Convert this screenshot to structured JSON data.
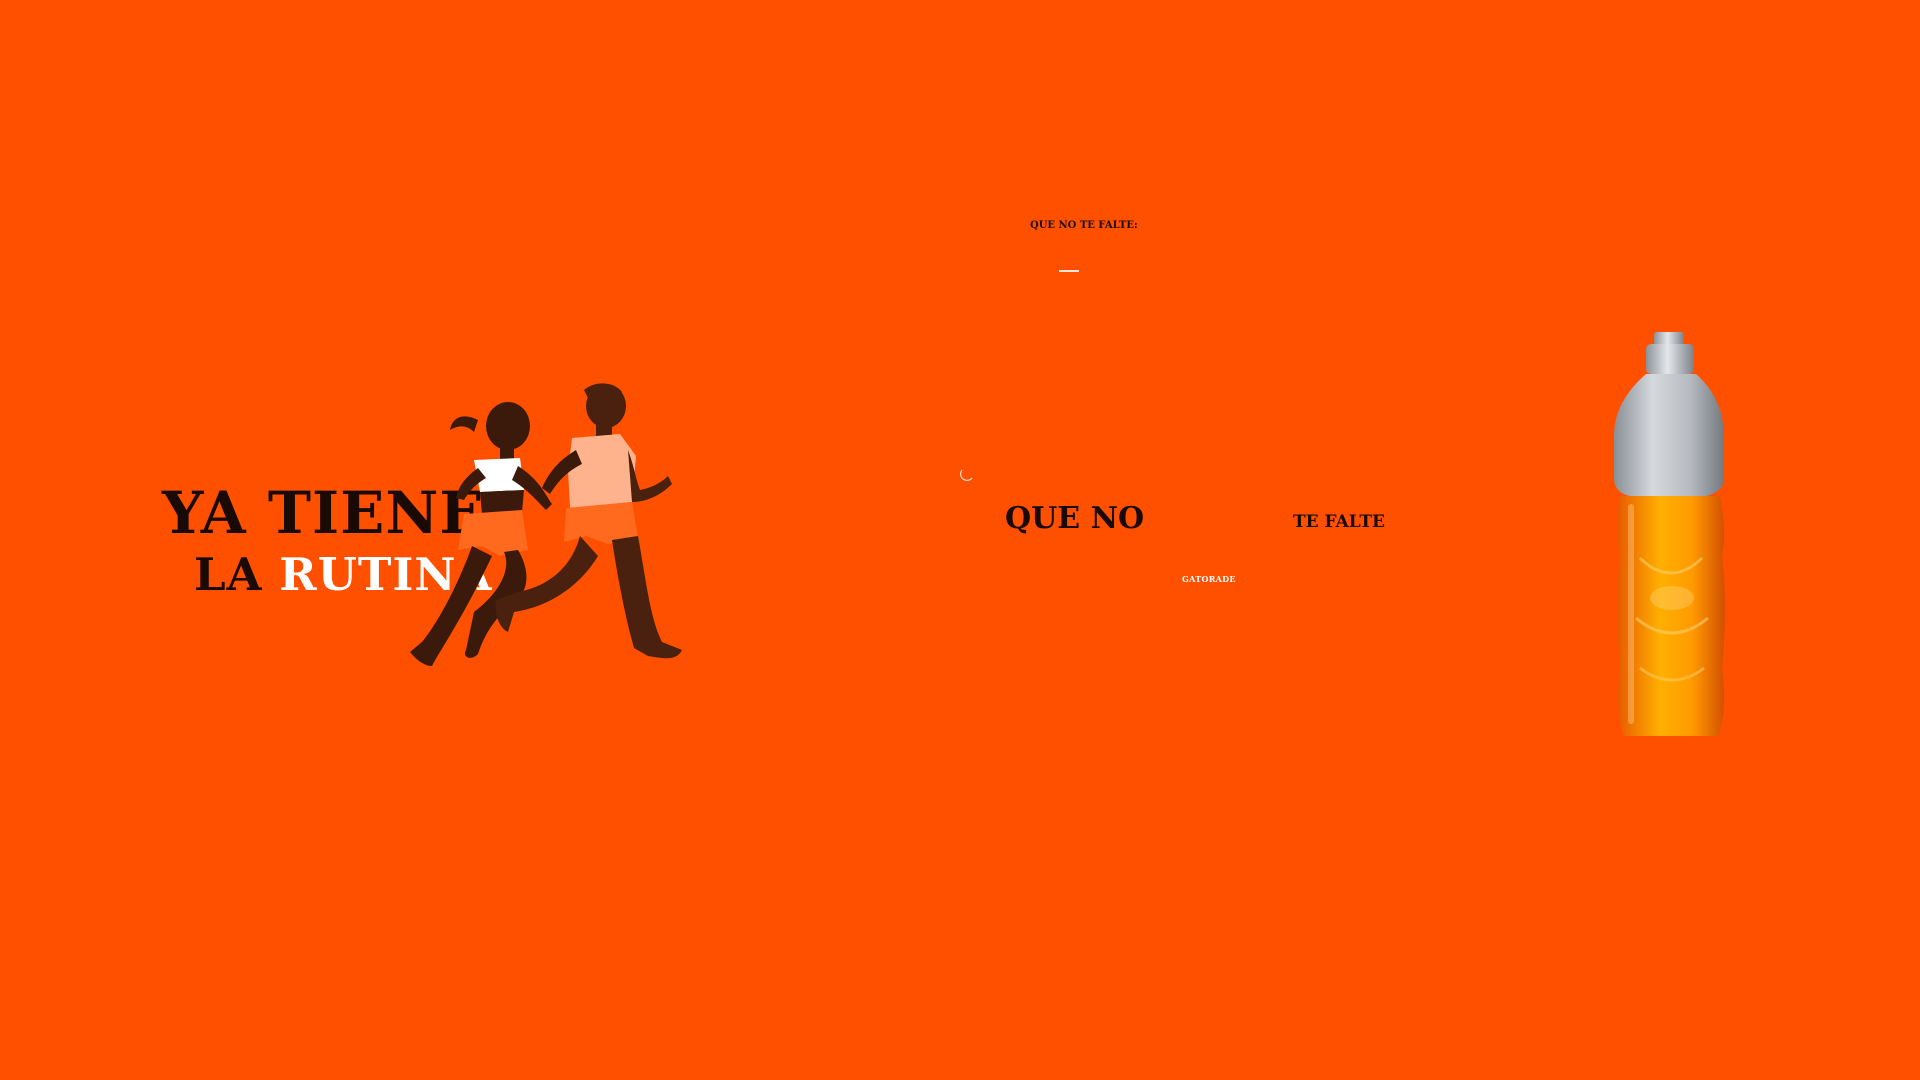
{
  "headline": {
    "line1": "YA TIENES",
    "line2_part1": "LA ",
    "line2_part2": "RUTINA"
  },
  "middle": {
    "small_heading": "QUE NO TE FALTE:",
    "main_text_left": "QUE NO",
    "main_text_right": "TE FALTE",
    "brand": "GATORADE"
  },
  "colors": {
    "background": "#ff5000",
    "text_dark": "#1a0a05",
    "text_light": "#ffffff"
  },
  "icons": {
    "loading": "spinner-icon",
    "illustration": "runners-illustration",
    "product": "bottle-image"
  }
}
